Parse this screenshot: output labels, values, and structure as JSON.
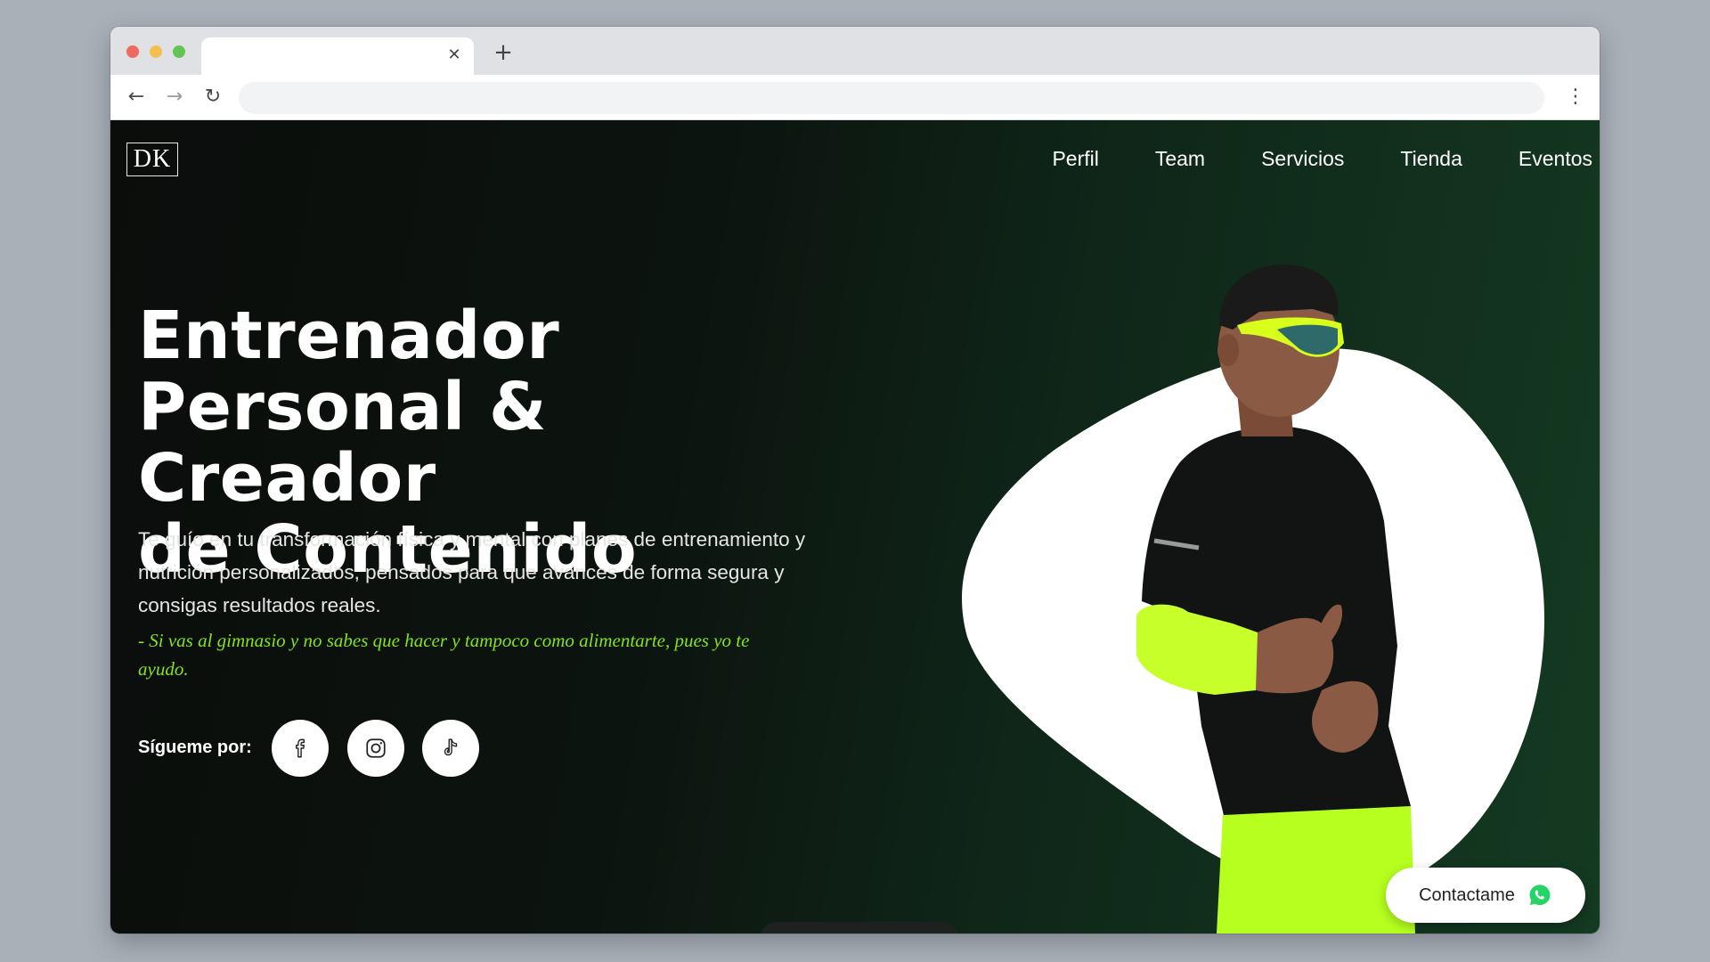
{
  "browser": {
    "tab_close_icon": "close-icon",
    "new_tab_icon": "plus-icon",
    "back_icon": "arrow-left-icon",
    "forward_icon": "arrow-right-icon",
    "reload_icon": "reload-icon",
    "menu_icon": "vertical-dots-icon",
    "address": ""
  },
  "header": {
    "logo": "DK",
    "nav": [
      "Perfil",
      "Team",
      "Servicios",
      "Tienda",
      "Eventos"
    ]
  },
  "hero": {
    "title_lines": [
      "Entrenador",
      "Personal & Creador",
      "de Contenido"
    ],
    "description": "Te guío en tu transformación física y mental con planes de entrenamiento y nutrición personalizados, pensados para que avances de forma segura y consigas resultados reales.",
    "quote": "- Si vas al gimnasio y no sabes que hacer y tampoco como alimentarte, pues yo te ayudo.",
    "follow_label": "Sígueme por:",
    "socials": [
      {
        "name": "facebook",
        "icon": "facebook-icon"
      },
      {
        "name": "instagram",
        "icon": "instagram-icon"
      },
      {
        "name": "tiktok",
        "icon": "tiktok-icon"
      }
    ]
  },
  "contact": {
    "label": "Contactame",
    "icon": "whatsapp-icon"
  },
  "colors": {
    "accent_green": "#84e21a",
    "neon_green": "#b6ff1f",
    "background_dark": "#0b0d0b",
    "background_green": "#143a21",
    "whatsapp_green": "#25d366"
  }
}
